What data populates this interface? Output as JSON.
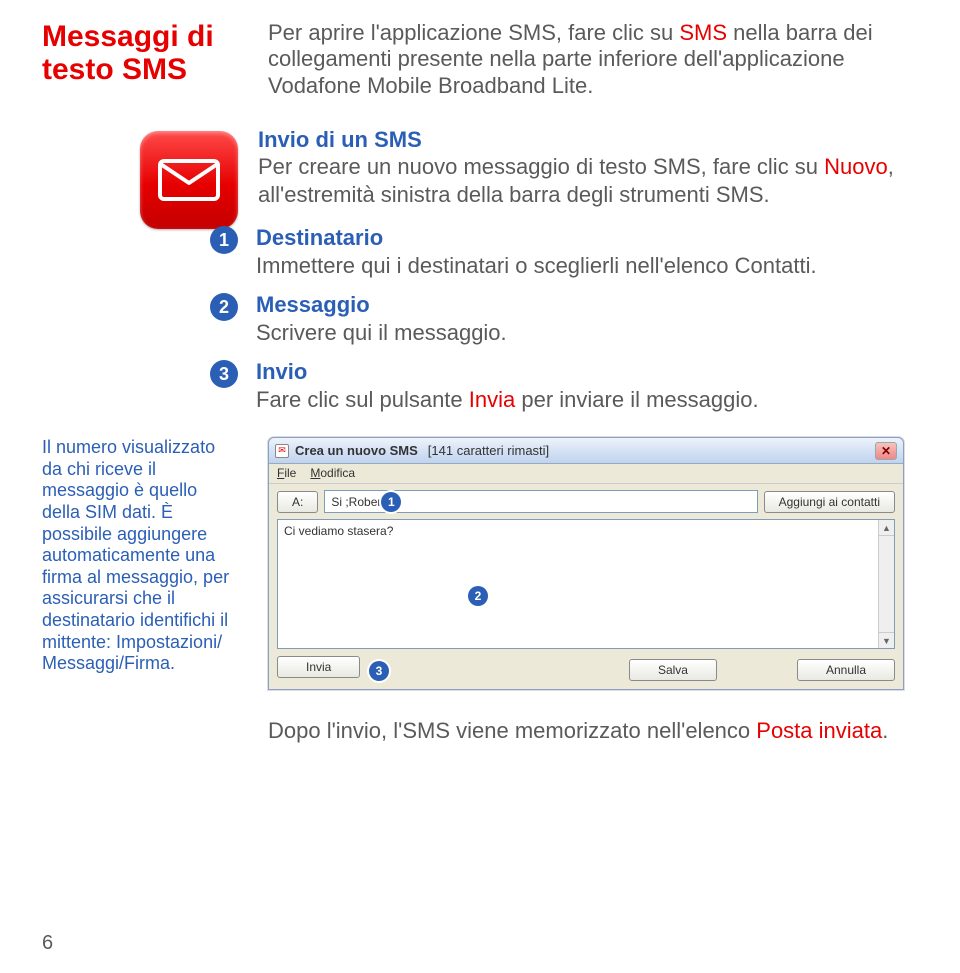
{
  "title": "Messaggi di testo SMS",
  "intro": {
    "t1": "Per aprire l'applicazione SMS, fare clic su ",
    "sms": "SMS",
    "t2": " nella barra dei collegamenti presente nella parte inferiore dell'applicazione Vodafone Mobile Broadband Lite."
  },
  "section1": {
    "heading": "Invio di un SMS",
    "body1": "Per creare un nuovo messaggio di testo SMS, fare clic su ",
    "nuovo": "Nuovo",
    "body2": ", all'estremità sinistra della barra degli strumenti SMS."
  },
  "steps": [
    {
      "n": "1",
      "title": "Destinatario",
      "body": "Immettere qui i destinatari o sceglierli nell'elenco Contatti."
    },
    {
      "n": "2",
      "title": "Messaggio",
      "body": "Scrivere qui il messaggio."
    },
    {
      "n": "3",
      "title": "Invio",
      "body_pre": "Fare clic sul pulsante ",
      "body_red": "Invia",
      "body_post": " per inviare il messaggio."
    }
  ],
  "sim_note": "Il numero visualizzato da chi riceve il messaggio è quello della SIM dati. È possibile aggiungere automaticamente una firma al messaggio, per assicurarsi che il destinatario identifichi il mittente: Impostazioni/ Messaggi/Firma.",
  "dialog": {
    "title": "Crea un nuovo SMS",
    "remaining": "[141 caratteri rimasti]",
    "menu_file": "File",
    "menu_file_u": "F",
    "menu_mod": "Modifica",
    "menu_mod_u": "M",
    "to_btn": "A:",
    "to_value": "Si       ;Roberto;",
    "add_btn": "Aggiungi ai contatti",
    "msg_value": "Ci vediamo stasera?",
    "send": "Invia",
    "save": "Salva",
    "cancel": "Annulla",
    "badge1": "1",
    "badge2": "2",
    "badge3": "3"
  },
  "after": {
    "t1": "Dopo l'invio, l'SMS viene memorizzato nell'elenco ",
    "red": "Posta inviata",
    "t2": "."
  },
  "page_number": "6"
}
